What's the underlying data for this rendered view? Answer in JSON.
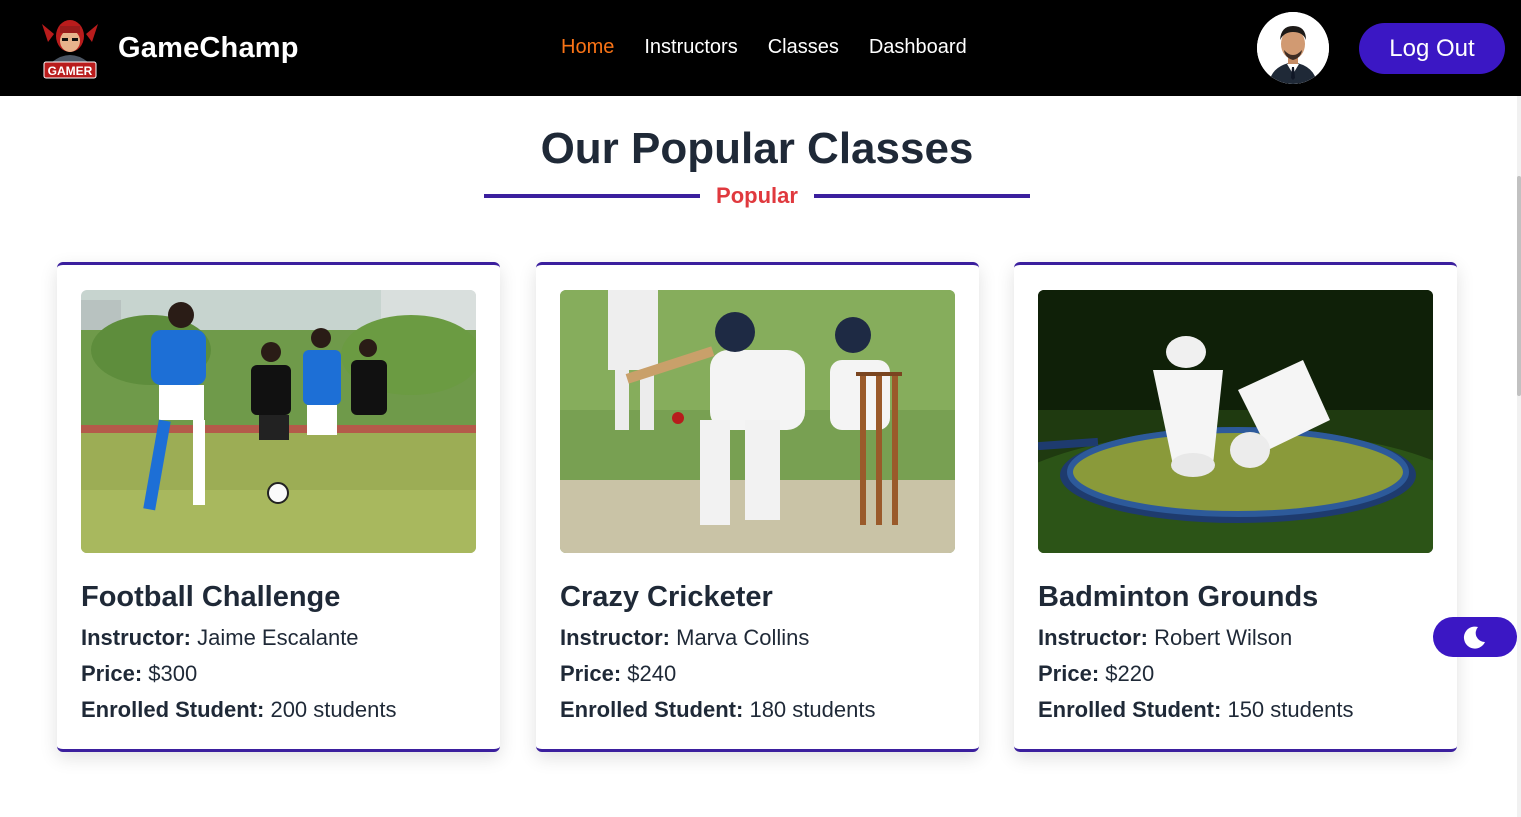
{
  "navbar": {
    "brand": "GameChamp",
    "logo_text": "GAMER",
    "links": [
      "Home",
      "Instructors",
      "Classes",
      "Dashboard"
    ],
    "active_link": "Home",
    "logout_label": "Log Out"
  },
  "section": {
    "title": "Our Popular Classes",
    "subtitle": "Popular"
  },
  "labels": {
    "instructor": "Instructor:",
    "price": "Price:",
    "enrolled": "Enrolled Student:"
  },
  "classes": [
    {
      "name": "Football Challenge",
      "instructor": "Jaime Escalante",
      "price": "$300",
      "enrolled": "200 students",
      "image_icon": "football-photo"
    },
    {
      "name": "Crazy Cricketer",
      "instructor": "Marva Collins",
      "price": "$240",
      "enrolled": "180 students",
      "image_icon": "cricket-photo"
    },
    {
      "name": "Badminton Grounds",
      "instructor": "Robert Wilson",
      "price": "$220",
      "enrolled": "150 students",
      "image_icon": "badminton-photo"
    }
  ],
  "colors": {
    "navbar_bg": "#000000",
    "accent": "#3b17c4",
    "card_border": "#3b1f9e",
    "active_link": "#f97316",
    "subtitle": "#e0393e"
  },
  "icons": {
    "theme_toggle": "moon-icon",
    "avatar": "user-avatar"
  }
}
